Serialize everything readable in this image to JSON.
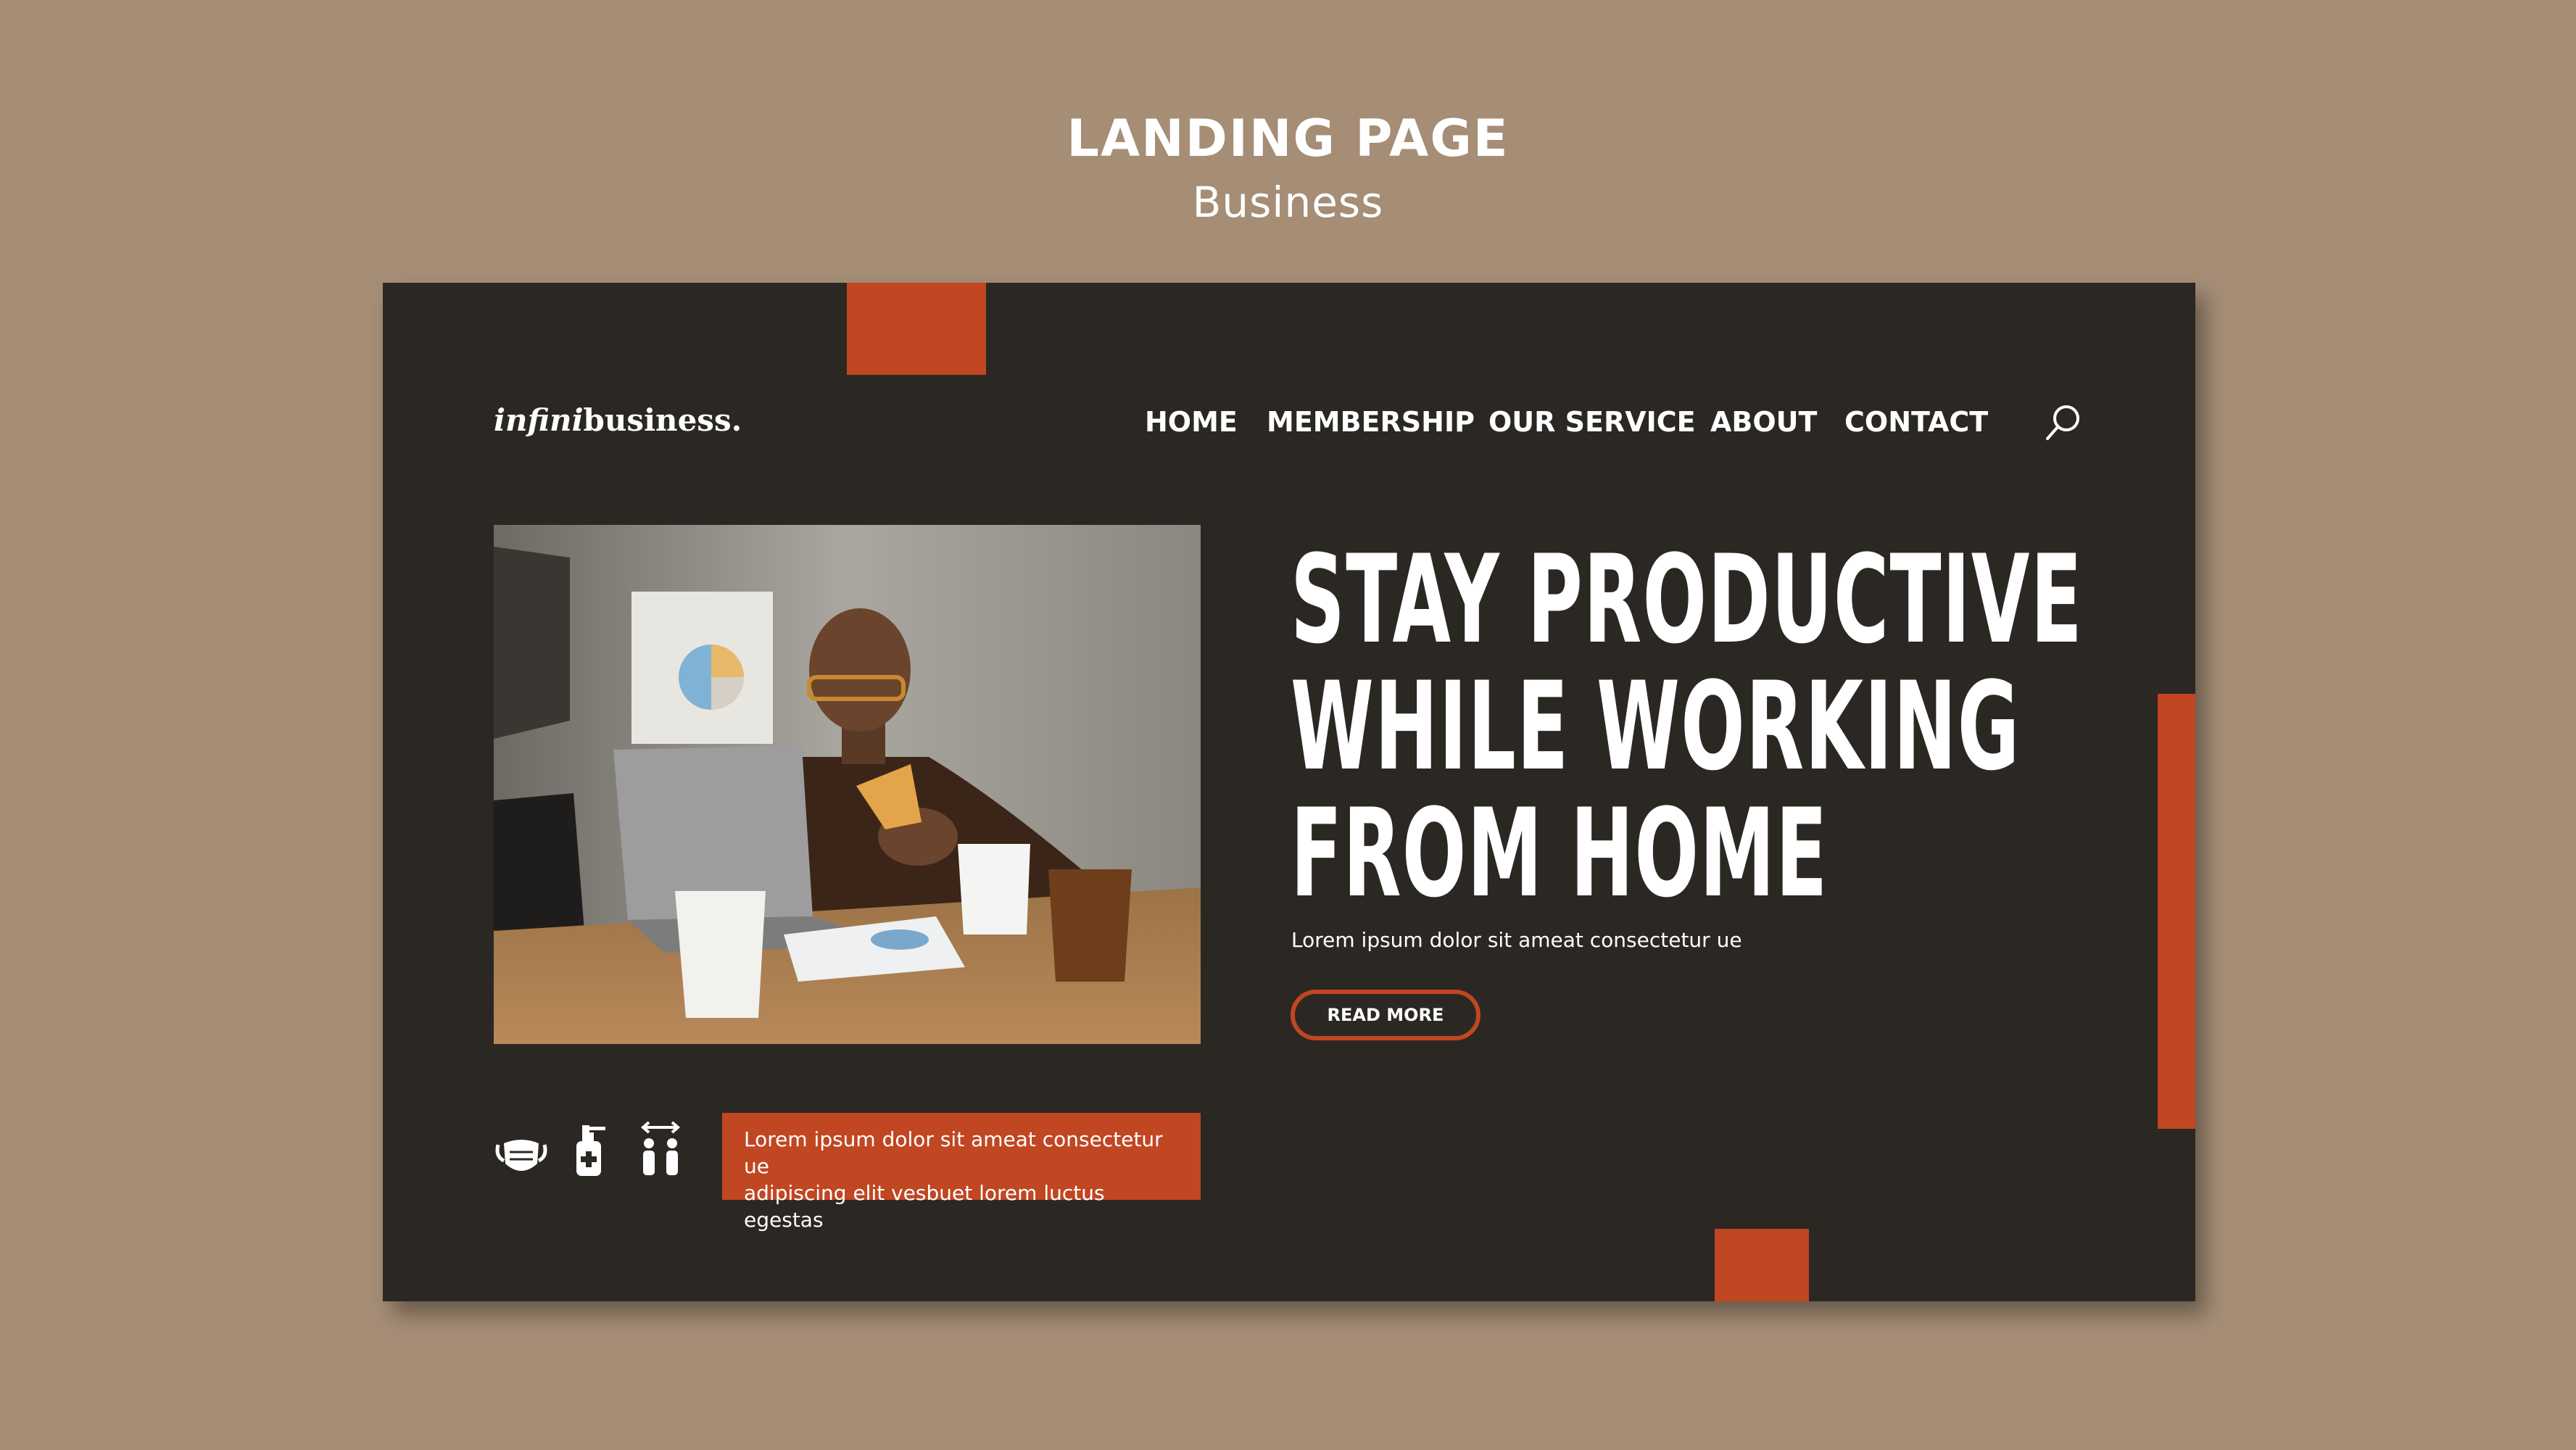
{
  "page": {
    "title": "LANDING PAGE",
    "subtitle": "Business"
  },
  "colors": {
    "background": "#a58d76",
    "card": "#2b2824",
    "accent": "#c14622",
    "text": "#ffffff"
  },
  "header": {
    "logo_italic": "infini",
    "logo_rest": "business.",
    "nav": [
      {
        "label": "HOME"
      },
      {
        "label": "MEMBERSHIP"
      },
      {
        "label": "OUR SERVICE"
      },
      {
        "label": "ABOUT"
      },
      {
        "label": "CONTACT"
      }
    ],
    "search_icon": "search-icon"
  },
  "hero": {
    "image": "man-with-laptop-eating-pizza-photo",
    "headline": [
      "STAY PRODUCTIVE",
      "WHILE WORKING",
      "FROM HOME"
    ],
    "subtext": "Lorem ipsum dolor sit ameat consectetur ue",
    "cta_label": "READ MORE"
  },
  "safety": {
    "icons": [
      "face-mask-icon",
      "hand-sanitizer-icon",
      "social-distance-icon"
    ],
    "notice_line1": "Lorem ipsum dolor sit ameat consectetur ue",
    "notice_line2": "adipiscing elit vesbuet lorem luctus egestas"
  }
}
